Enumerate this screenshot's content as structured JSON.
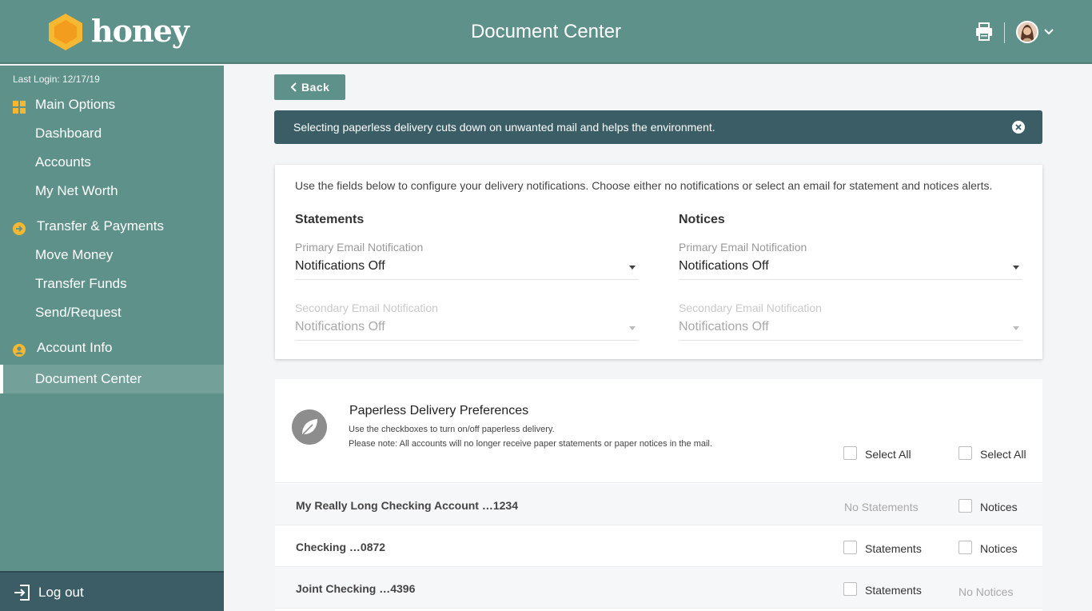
{
  "brand": {
    "name": "honey",
    "accent": "#f6b830",
    "primary": "#5e9189",
    "dark": "#3a5d66"
  },
  "header": {
    "title": "Document Center",
    "icons": [
      "print-icon",
      "avatar",
      "chevron-down-icon"
    ]
  },
  "sidebar": {
    "last_login": "Last Login: 12/17/19",
    "sections": [
      {
        "label": "Main Options",
        "icon": "grid-icon",
        "items": [
          "Dashboard",
          "Accounts",
          "My Net Worth"
        ]
      },
      {
        "label": "Transfer & Payments",
        "icon": "arrow-circle-icon",
        "items": [
          "Move Money",
          "Transfer Funds",
          "Send/Request"
        ]
      },
      {
        "label": "Account Info",
        "icon": "user-circle-icon",
        "items": [
          "Document Center"
        ]
      }
    ],
    "active_item": "Document Center",
    "logout": "Log out"
  },
  "main": {
    "back_label": "Back",
    "banner": "Selecting paperless delivery cuts down on unwanted mail and helps the environment.",
    "config": {
      "intro": "Use the fields below to configure your delivery notifications. Choose either no notifications or select an email for statement and notices alerts.",
      "statements": {
        "title": "Statements",
        "primary_label": "Primary Email Notification",
        "primary_value": "Notifications Off",
        "secondary_label": "Secondary Email Notification",
        "secondary_value": "Notifications Off"
      },
      "notices": {
        "title": "Notices",
        "primary_label": "Primary Email Notification",
        "primary_value": "Notifications Off",
        "secondary_label": "Secondary Email Notification",
        "secondary_value": "Notifications Off"
      }
    },
    "paperless": {
      "title": "Paperless Delivery Preferences",
      "sub1": "Use the checkboxes to turn on/off paperless delivery.",
      "sub2": "Please note: All accounts will no longer receive paper statements or paper notices in the mail.",
      "select_all_statements": "Select All",
      "select_all_notices": "Select All",
      "accounts": [
        {
          "name": "My Really Long Checking Account …1234",
          "statements": "No Statements",
          "notices": "Notices"
        },
        {
          "name": "Checking …0872",
          "statements": "Statements",
          "notices": "Notices"
        },
        {
          "name": "Joint Checking …4396",
          "statements": "Statements",
          "notices": "No Notices"
        }
      ]
    }
  }
}
